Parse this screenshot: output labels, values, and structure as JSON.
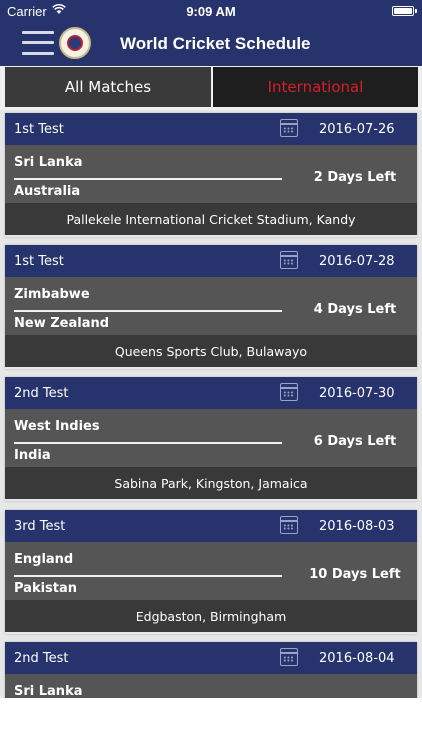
{
  "status_bar": {
    "carrier": "Carrier",
    "time": "9:09 AM"
  },
  "nav": {
    "title": "World Cricket Schedule"
  },
  "tabs": [
    {
      "label": "All Matches",
      "selected": false
    },
    {
      "label": "International",
      "selected": true
    }
  ],
  "colors": {
    "nav_bg": "#27336d",
    "selected_tab_text": "#d41e2b"
  },
  "matches": [
    {
      "type": "1st Test",
      "date": "2016-07-26",
      "team_a": "Sri Lanka",
      "team_b": "Australia",
      "days_left": "2 Days Left",
      "venue": "Pallekele International Cricket Stadium, Kandy"
    },
    {
      "type": "1st Test",
      "date": "2016-07-28",
      "team_a": "Zimbabwe",
      "team_b": "New Zealand",
      "days_left": "4 Days Left",
      "venue": "Queens Sports Club, Bulawayo"
    },
    {
      "type": "2nd Test",
      "date": "2016-07-30",
      "team_a": "West Indies",
      "team_b": "India",
      "days_left": "6 Days Left",
      "venue": "Sabina Park, Kingston, Jamaica"
    },
    {
      "type": "3rd Test",
      "date": "2016-08-03",
      "team_a": "England",
      "team_b": "Pakistan",
      "days_left": "10 Days Left",
      "venue": "Edgbaston, Birmingham"
    },
    {
      "type": "2nd Test",
      "date": "2016-08-04",
      "team_a": "Sri Lanka"
    }
  ]
}
